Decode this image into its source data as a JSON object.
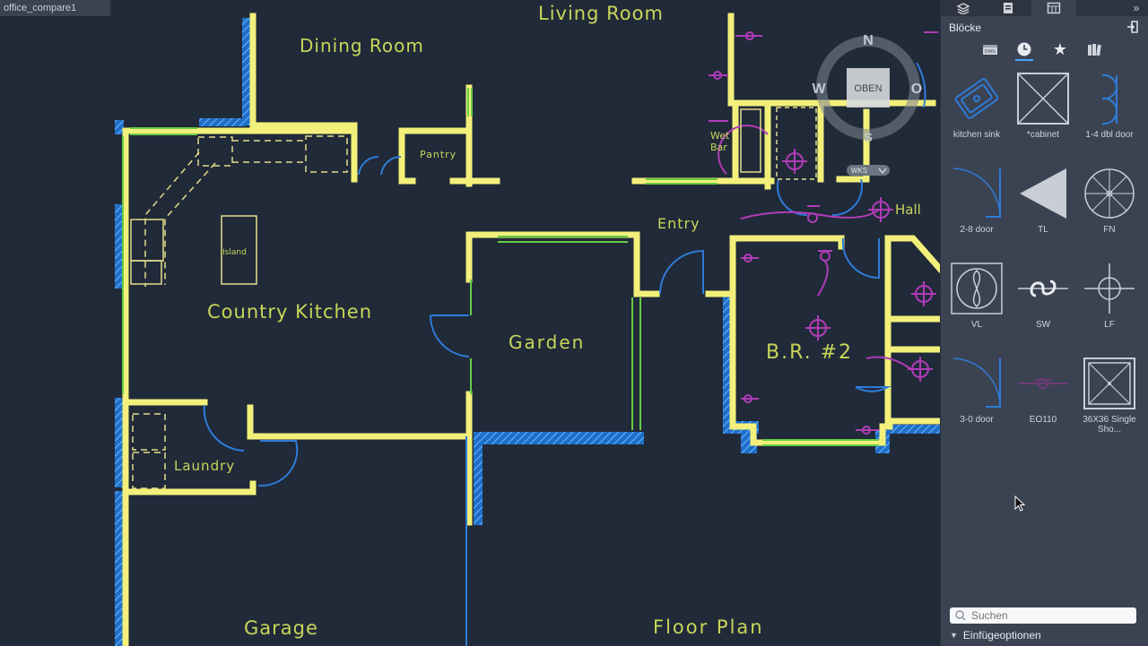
{
  "document_tab": {
    "title": "office_compare1"
  },
  "drawing": {
    "room_labels": {
      "living_room": "Living Room",
      "dining_room": "Dining Room",
      "pantry": "Pantry",
      "wet": "Wet",
      "bar": "Bar",
      "hall": "Hall",
      "entry": "Entry",
      "island": "Island",
      "country_kitchen": "Country Kitchen",
      "garden": "Garden",
      "br2": "B.R. #2",
      "laundry": "Laundry",
      "garage": "Garage",
      "floor_plan": "Floor Plan"
    },
    "viewcube": {
      "north": "N",
      "west": "W",
      "east": "O",
      "south": "S",
      "face": "OBEN",
      "ucs": "WKS"
    }
  },
  "panel": {
    "title": "Blöcke",
    "tabs": [
      {
        "icon": "layers-icon"
      },
      {
        "icon": "document-icon"
      },
      {
        "icon": "table-icon"
      }
    ],
    "categories": [
      {
        "icon": "dwg-file-icon"
      },
      {
        "icon": "clock-icon"
      },
      {
        "icon": "star-icon"
      },
      {
        "icon": "library-icon"
      }
    ],
    "blocks": [
      {
        "label": "kitchen sink",
        "icon": "kitchen-sink-block-icon"
      },
      {
        "label": "*cabinet",
        "icon": "cabinet-block-icon"
      },
      {
        "label": "1-4 dbl door",
        "icon": "double-door-block-icon"
      },
      {
        "label": "2-8 door",
        "icon": "door-block-icon"
      },
      {
        "label": "TL",
        "icon": "triangle-block-icon"
      },
      {
        "label": "FN",
        "icon": "fan-block-icon"
      },
      {
        "label": "VL",
        "icon": "vent-light-block-icon"
      },
      {
        "label": "SW",
        "icon": "switch-block-icon"
      },
      {
        "label": "LF",
        "icon": "light-fixture-block-icon"
      },
      {
        "label": "3-0 door",
        "icon": "door-block-icon"
      },
      {
        "label": "EO110",
        "icon": "outlet-block-icon"
      },
      {
        "label": "36X36 Single Sho...",
        "icon": "shower-block-icon"
      }
    ],
    "search": {
      "placeholder": "Suchen"
    },
    "insert_options": "Einfügeoptionen"
  },
  "colors": {
    "canvas": "#212a38",
    "wall": "#f2f07a",
    "wall_green": "#66cc44",
    "door": "#2f7bd8",
    "electric": "#b03cb8",
    "label": "#c8d65a",
    "panel": "#3b4352"
  }
}
